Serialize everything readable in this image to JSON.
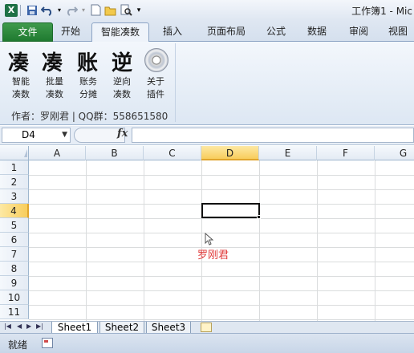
{
  "titlebar": {
    "title": "工作簿1 - Mic",
    "app_icon": "X"
  },
  "tabs": [
    "文件",
    "开始",
    "智能凑数",
    "插入",
    "页面布局",
    "公式",
    "数据",
    "审阅",
    "视图"
  ],
  "ribbon": {
    "big_chars": [
      "凑",
      "凑",
      "账",
      "逆"
    ],
    "buttons": [
      {
        "line1": "智能",
        "line2": "凑数"
      },
      {
        "line1": "批量",
        "line2": "凑数"
      },
      {
        "line1": "账务",
        "line2": "分摊"
      },
      {
        "line1": "逆向",
        "line2": "凑数"
      },
      {
        "line1": "关于",
        "line2": "插件"
      }
    ],
    "author": "作者：罗刚君 | QQ群：558651580"
  },
  "formula_bar": {
    "name_box": "D4",
    "fx": "fx",
    "content": ""
  },
  "grid": {
    "columns": [
      "A",
      "B",
      "C",
      "D",
      "E",
      "F",
      "G"
    ],
    "selected_column": "D",
    "rows": [
      "1",
      "2",
      "3",
      "4",
      "5",
      "6",
      "7",
      "8",
      "9",
      "10",
      "11"
    ],
    "selected_row": "4",
    "cell_d7": "罗刚君",
    "cell_d7_color": "#e03a3a"
  },
  "sheets": [
    "Sheet1",
    "Sheet2",
    "Sheet3"
  ],
  "active_sheet": "Sheet1",
  "status": {
    "text": "就绪"
  }
}
